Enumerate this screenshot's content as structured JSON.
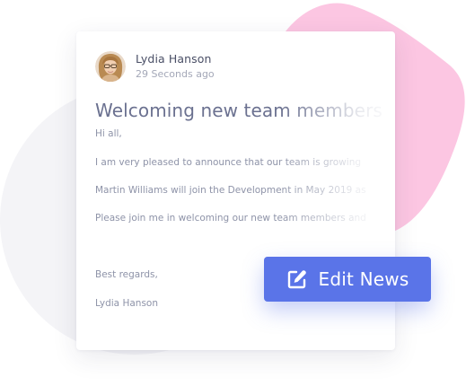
{
  "post": {
    "author": "Lydia Hanson",
    "time": "29 Seconds ago",
    "title": "Welcoming new team members",
    "lines": [
      "Hi all,",
      "I am very pleased to announce that our team is growing",
      "Martin Williams will join the Development in May 2019 as",
      "Please join me in welcoming our new team members and",
      "Best regards,",
      "Lydia Hanson"
    ]
  },
  "action": {
    "label": "Edit News",
    "icon": "edit-icon"
  },
  "colors": {
    "accent": "#5a74e8",
    "blob": "#fcc6e2",
    "backdrop": "#f4f4f7"
  }
}
